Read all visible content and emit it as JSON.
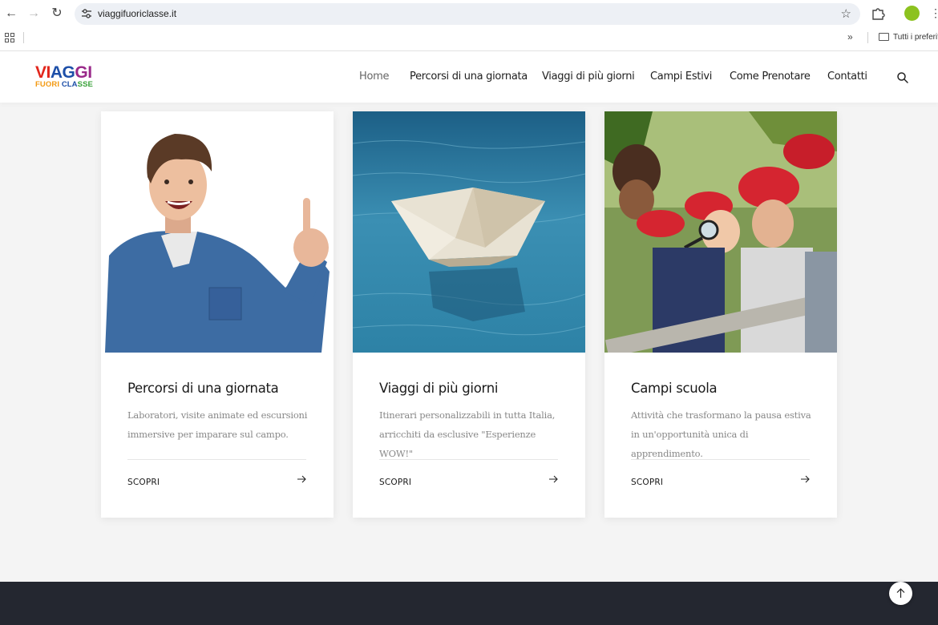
{
  "browser": {
    "url": "viaggifuoriclasse.it",
    "bookmarks_folder": "Tutti i preferiti",
    "more_glyph": "»"
  },
  "site": {
    "logo": {
      "line1": "VIAGGI",
      "line2": "FUORI CLASSE"
    },
    "nav": [
      "Home",
      "Percorsi di una giornata",
      "Viaggi di più giorni",
      "Campi Estivi",
      "Come Prenotare",
      "Contatti"
    ],
    "active_nav": "Home"
  },
  "cards": [
    {
      "title": "Percorsi di una giornata",
      "description": "Laboratori, visite animate ed escursioni immersive per imparare sul campo.",
      "link": "SCOPRI",
      "image": "smiling-boy-pointing-up"
    },
    {
      "title": "Viaggi di più giorni",
      "description": "Itinerari personalizzabili in tutta Italia, arricchiti da esclusive \"Esperienze WOW!\"",
      "link": "SCOPRI",
      "image": "paper-boat-on-water"
    },
    {
      "title": "Campi scuola",
      "description": "Attività che trasformano la pausa estiva in un'opportunità unica di apprendimento.",
      "link": "SCOPRI",
      "image": "children-with-red-caps-and-magnifying-glass"
    }
  ],
  "colors": {
    "accent_green": "#8cc21f",
    "footer_bg": "#242730",
    "page_bg": "#f4f4f4"
  }
}
